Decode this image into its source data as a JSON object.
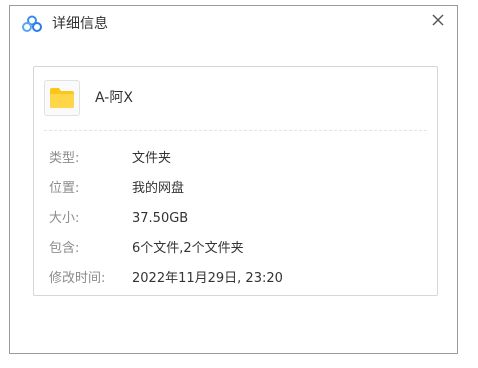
{
  "dialog": {
    "title": "详细信息",
    "close_icon": "close-icon",
    "logo_icon": "baidu-netdisk-logo-icon"
  },
  "file": {
    "name": "A-阿X",
    "icon": "folder-icon",
    "folder_color": "#ffc61a"
  },
  "details": [
    {
      "label": "类型:",
      "value": "文件夹"
    },
    {
      "label": "位置:",
      "value": "我的网盘"
    },
    {
      "label": "大小:",
      "value": "37.50GB"
    },
    {
      "label": "包含:",
      "value": "6个文件,2个文件夹"
    },
    {
      "label": "修改时间:",
      "value": "2022年11月29日, 23:20"
    }
  ],
  "colors": {
    "label": "#8c8c8c",
    "value": "#333333",
    "logo_blue": "#3b8cf0"
  }
}
